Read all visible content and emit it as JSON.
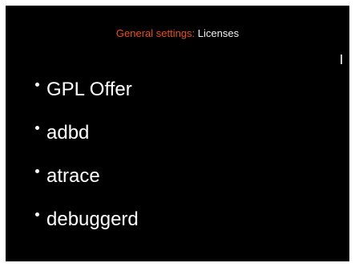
{
  "header": {
    "prefix": "General settings:",
    "current": "Licenses"
  },
  "licenses": {
    "items": [
      {
        "label": "GPL Offer"
      },
      {
        "label": "adbd"
      },
      {
        "label": "atrace"
      },
      {
        "label": "debuggerd"
      }
    ]
  },
  "colors": {
    "background": "#000000",
    "accent": "#e8501e",
    "text": "#ffffff"
  }
}
